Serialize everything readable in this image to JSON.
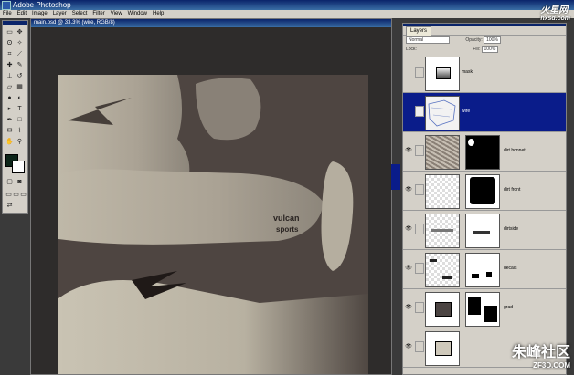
{
  "app": {
    "title": "Adobe Photoshop"
  },
  "menu": [
    "File",
    "Edit",
    "Image",
    "Layer",
    "Select",
    "Filter",
    "View",
    "Window",
    "Help"
  ],
  "document": {
    "title": "main.psd @ 33.3% (wire, RGB/8)"
  },
  "canvas_text": [
    "vulcan",
    "sports"
  ],
  "layers_panel": {
    "tab": "Layers",
    "blend_mode": "Normal",
    "opacity_label": "Opacity:",
    "opacity_value": "100%",
    "lock_label": "Lock:",
    "fill_label": "Fill:",
    "fill_value": "100%",
    "layers": [
      {
        "name": "mask",
        "selected": false,
        "visible": false
      },
      {
        "name": "wire",
        "selected": true,
        "visible": false
      },
      {
        "name": "dirt bonnet",
        "selected": false,
        "visible": true
      },
      {
        "name": "dirt front",
        "selected": false,
        "visible": true
      },
      {
        "name": "dirtside",
        "selected": false,
        "visible": true
      },
      {
        "name": "decals",
        "selected": false,
        "visible": true
      },
      {
        "name": "grad",
        "selected": false,
        "visible": true
      },
      {
        "name": "",
        "selected": false,
        "visible": true
      }
    ]
  },
  "watermark": {
    "top": "火星网",
    "top_sub": "hxsd.com",
    "bottom": "朱峰社区",
    "bottom_sub": "ZF3D.COM"
  }
}
